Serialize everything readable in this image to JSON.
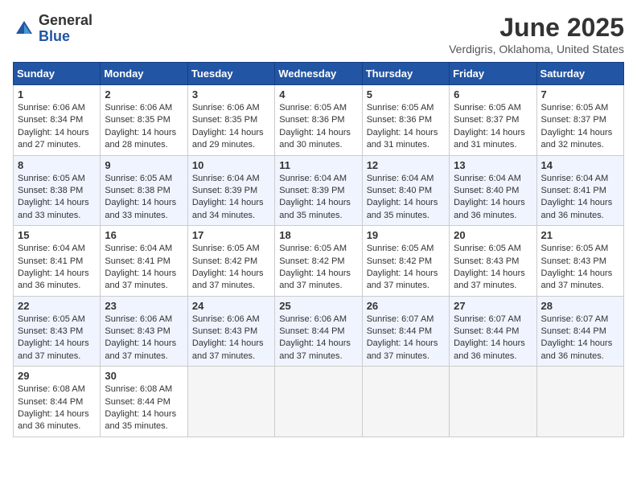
{
  "logo": {
    "general": "General",
    "blue": "Blue"
  },
  "title": "June 2025",
  "location": "Verdigris, Oklahoma, United States",
  "headers": [
    "Sunday",
    "Monday",
    "Tuesday",
    "Wednesday",
    "Thursday",
    "Friday",
    "Saturday"
  ],
  "weeks": [
    [
      {
        "day": "1",
        "sunrise": "6:06 AM",
        "sunset": "8:34 PM",
        "daylight": "14 hours and 27 minutes."
      },
      {
        "day": "2",
        "sunrise": "6:06 AM",
        "sunset": "8:35 PM",
        "daylight": "14 hours and 28 minutes."
      },
      {
        "day": "3",
        "sunrise": "6:06 AM",
        "sunset": "8:35 PM",
        "daylight": "14 hours and 29 minutes."
      },
      {
        "day": "4",
        "sunrise": "6:05 AM",
        "sunset": "8:36 PM",
        "daylight": "14 hours and 30 minutes."
      },
      {
        "day": "5",
        "sunrise": "6:05 AM",
        "sunset": "8:36 PM",
        "daylight": "14 hours and 31 minutes."
      },
      {
        "day": "6",
        "sunrise": "6:05 AM",
        "sunset": "8:37 PM",
        "daylight": "14 hours and 31 minutes."
      },
      {
        "day": "7",
        "sunrise": "6:05 AM",
        "sunset": "8:37 PM",
        "daylight": "14 hours and 32 minutes."
      }
    ],
    [
      {
        "day": "8",
        "sunrise": "6:05 AM",
        "sunset": "8:38 PM",
        "daylight": "14 hours and 33 minutes."
      },
      {
        "day": "9",
        "sunrise": "6:05 AM",
        "sunset": "8:38 PM",
        "daylight": "14 hours and 33 minutes."
      },
      {
        "day": "10",
        "sunrise": "6:04 AM",
        "sunset": "8:39 PM",
        "daylight": "14 hours and 34 minutes."
      },
      {
        "day": "11",
        "sunrise": "6:04 AM",
        "sunset": "8:39 PM",
        "daylight": "14 hours and 35 minutes."
      },
      {
        "day": "12",
        "sunrise": "6:04 AM",
        "sunset": "8:40 PM",
        "daylight": "14 hours and 35 minutes."
      },
      {
        "day": "13",
        "sunrise": "6:04 AM",
        "sunset": "8:40 PM",
        "daylight": "14 hours and 36 minutes."
      },
      {
        "day": "14",
        "sunrise": "6:04 AM",
        "sunset": "8:41 PM",
        "daylight": "14 hours and 36 minutes."
      }
    ],
    [
      {
        "day": "15",
        "sunrise": "6:04 AM",
        "sunset": "8:41 PM",
        "daylight": "14 hours and 36 minutes."
      },
      {
        "day": "16",
        "sunrise": "6:04 AM",
        "sunset": "8:41 PM",
        "daylight": "14 hours and 37 minutes."
      },
      {
        "day": "17",
        "sunrise": "6:05 AM",
        "sunset": "8:42 PM",
        "daylight": "14 hours and 37 minutes."
      },
      {
        "day": "18",
        "sunrise": "6:05 AM",
        "sunset": "8:42 PM",
        "daylight": "14 hours and 37 minutes."
      },
      {
        "day": "19",
        "sunrise": "6:05 AM",
        "sunset": "8:42 PM",
        "daylight": "14 hours and 37 minutes."
      },
      {
        "day": "20",
        "sunrise": "6:05 AM",
        "sunset": "8:43 PM",
        "daylight": "14 hours and 37 minutes."
      },
      {
        "day": "21",
        "sunrise": "6:05 AM",
        "sunset": "8:43 PM",
        "daylight": "14 hours and 37 minutes."
      }
    ],
    [
      {
        "day": "22",
        "sunrise": "6:05 AM",
        "sunset": "8:43 PM",
        "daylight": "14 hours and 37 minutes."
      },
      {
        "day": "23",
        "sunrise": "6:06 AM",
        "sunset": "8:43 PM",
        "daylight": "14 hours and 37 minutes."
      },
      {
        "day": "24",
        "sunrise": "6:06 AM",
        "sunset": "8:43 PM",
        "daylight": "14 hours and 37 minutes."
      },
      {
        "day": "25",
        "sunrise": "6:06 AM",
        "sunset": "8:44 PM",
        "daylight": "14 hours and 37 minutes."
      },
      {
        "day": "26",
        "sunrise": "6:07 AM",
        "sunset": "8:44 PM",
        "daylight": "14 hours and 37 minutes."
      },
      {
        "day": "27",
        "sunrise": "6:07 AM",
        "sunset": "8:44 PM",
        "daylight": "14 hours and 36 minutes."
      },
      {
        "day": "28",
        "sunrise": "6:07 AM",
        "sunset": "8:44 PM",
        "daylight": "14 hours and 36 minutes."
      }
    ],
    [
      {
        "day": "29",
        "sunrise": "6:08 AM",
        "sunset": "8:44 PM",
        "daylight": "14 hours and 36 minutes."
      },
      {
        "day": "30",
        "sunrise": "6:08 AM",
        "sunset": "8:44 PM",
        "daylight": "14 hours and 35 minutes."
      },
      null,
      null,
      null,
      null,
      null
    ]
  ]
}
